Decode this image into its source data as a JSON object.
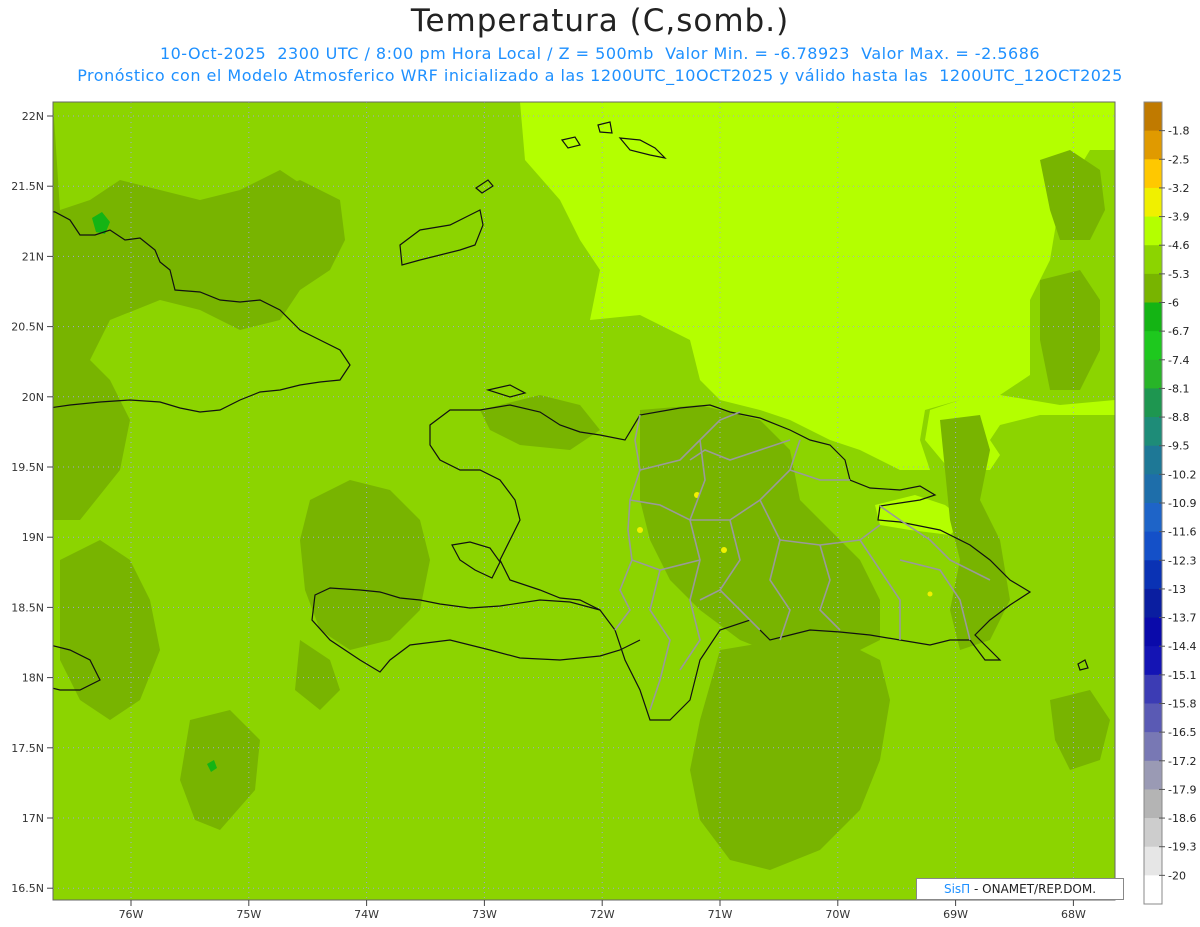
{
  "header": {
    "title": "Temperatura (C,somb.)",
    "line1": "10-Oct-2025  2300 UTC / 8:00 pm Hora Local / Z = 500mb  Valor Min. = -6.78923  Valor Max. = -2.5686",
    "line2": "Pronóstico con el Modelo Atmosferico WRF inicializado a las 1200UTC_10OCT2025 y válido hasta las  1200UTC_12OCT2025"
  },
  "axes": {
    "lat_labels": [
      "22N",
      "21.5N",
      "21N",
      "20.5N",
      "20N",
      "19.5N",
      "19N",
      "18.5N",
      "18N",
      "17.5N",
      "17N",
      "16.5N"
    ],
    "lon_labels": [
      "76W",
      "75W",
      "74W",
      "73W",
      "72W",
      "71W",
      "70W",
      "69W",
      "68W"
    ]
  },
  "colorbar": {
    "levels": [
      "-1.8",
      "-2.5",
      "-3.2",
      "-3.9",
      "-4.6",
      "-5.3",
      "-6",
      "-6.7",
      "-7.4",
      "-8.1",
      "-8.8",
      "-9.5",
      "-10.2",
      "-10.9",
      "-11.6",
      "-12.3",
      "-13",
      "-13.7",
      "-14.4",
      "-15.1",
      "-15.8",
      "-16.5",
      "-17.2",
      "-17.9",
      "-18.6",
      "-19.3",
      "-20"
    ],
    "colors": [
      "#c07a00",
      "#e09a00",
      "#ffc800",
      "#f0f000",
      "#b4ff00",
      "#8cd400",
      "#78b400",
      "#14b414",
      "#1ec81e",
      "#28b428",
      "#1e9650",
      "#1e8c78",
      "#1e7896",
      "#1e6eaa",
      "#1e64c8",
      "#1450c8",
      "#0a32b4",
      "#0a1ea0",
      "#0a0aaa",
      "#1414b4",
      "#3c3cb4",
      "#5a5ab4",
      "#7878b4",
      "#9a9ab4",
      "#b4b4b4",
      "#cdcdcd",
      "#e6e6e6",
      "#ffffff"
    ]
  },
  "credit": {
    "brand": "SisΠ",
    "text": " - ONAMET/REP.DOM."
  },
  "field_colors": {
    "base": "#8cd400",
    "warm": "#b4ff00",
    "cool": "#78b400",
    "coolest": "#14b414",
    "warm_spot": "#f0f000"
  }
}
